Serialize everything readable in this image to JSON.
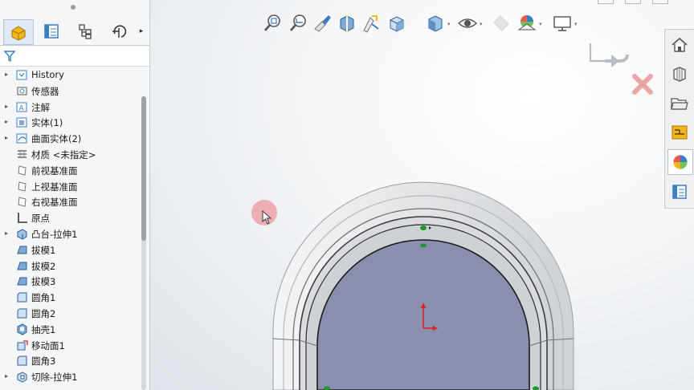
{
  "feature_tree": {
    "items": [
      {
        "label": "History",
        "icon": "history-icon",
        "expandable": true
      },
      {
        "label": "传感器",
        "icon": "sensor-icon",
        "expandable": false
      },
      {
        "label": "注解",
        "icon": "annotation-icon",
        "expandable": true
      },
      {
        "label": "实体(1)",
        "icon": "solid-bodies-icon",
        "expandable": true
      },
      {
        "label": "曲面实体(2)",
        "icon": "surface-bodies-icon",
        "expandable": true
      },
      {
        "label": "材质 <未指定>",
        "icon": "material-icon",
        "expandable": false
      },
      {
        "label": "前视基准面",
        "icon": "plane-icon",
        "expandable": false
      },
      {
        "label": "上视基准面",
        "icon": "plane-icon",
        "expandable": false
      },
      {
        "label": "右视基准面",
        "icon": "plane-icon",
        "expandable": false
      },
      {
        "label": "原点",
        "icon": "origin-icon",
        "expandable": false
      },
      {
        "label": "凸台-拉伸1",
        "icon": "extrude-boss-icon",
        "expandable": true
      },
      {
        "label": "拔模1",
        "icon": "draft-icon",
        "expandable": false
      },
      {
        "label": "拔模2",
        "icon": "draft-icon",
        "expandable": false
      },
      {
        "label": "拔模3",
        "icon": "draft-icon",
        "expandable": false
      },
      {
        "label": "圆角1",
        "icon": "fillet-icon",
        "expandable": false
      },
      {
        "label": "圆角2",
        "icon": "fillet-icon",
        "expandable": false
      },
      {
        "label": "抽壳1",
        "icon": "shell-icon",
        "expandable": false
      },
      {
        "label": "移动面1",
        "icon": "move-face-icon",
        "expandable": false
      },
      {
        "label": "圆角3",
        "icon": "fillet-icon",
        "expandable": false
      },
      {
        "label": "切除-拉伸1",
        "icon": "extrude-cut-icon",
        "expandable": true
      }
    ]
  },
  "colors": {
    "panel_bg": "#f5f6f7",
    "model_face": "#8a8fb0",
    "model_rim": "#e4e6e8",
    "edge_dark": "#1c1c1c",
    "axis_red": "#e02020",
    "point_green": "#1a9a2a",
    "cursor_highlight": "#ec96a0",
    "icon_blue": "#3a7fc4",
    "icon_yellow": "#f2b51c"
  }
}
